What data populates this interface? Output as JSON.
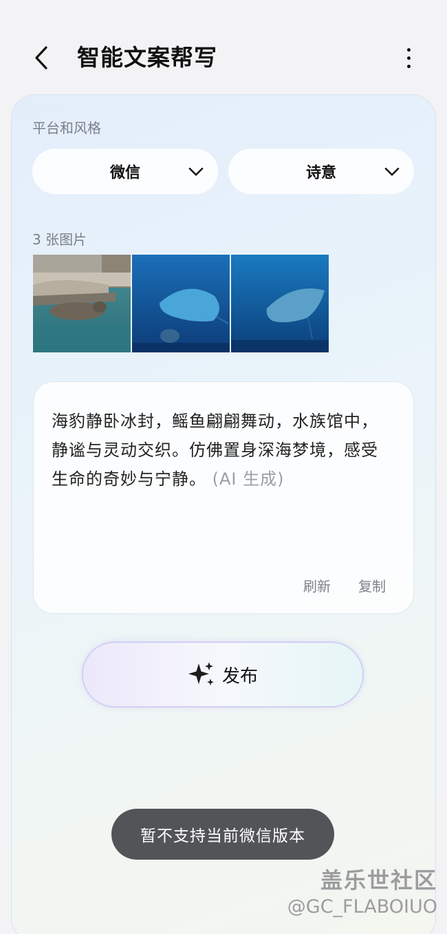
{
  "header": {
    "title": "智能文案帮写",
    "back_icon": "chevron-left-icon",
    "more_icon": "more-vertical-icon"
  },
  "platform_section": {
    "label": "平台和风格",
    "platform": {
      "value": "微信",
      "icon": "chevron-down-icon"
    },
    "style": {
      "value": "诗意",
      "icon": "chevron-down-icon"
    }
  },
  "images_section": {
    "label": "3 张图片",
    "images": [
      {
        "subject": "seal"
      },
      {
        "subject": "stingray"
      },
      {
        "subject": "stingray"
      }
    ]
  },
  "generated": {
    "text": "海豹静卧冰封，鳐鱼翩翩舞动，水族馆中，静谧与灵动交织。仿佛置身深海梦境，感受生命的奇妙与宁静。",
    "ai_tag": "(AI 生成)",
    "refresh_label": "刷新",
    "copy_label": "复制"
  },
  "publish": {
    "label": "发布",
    "icon": "sparkle-icon"
  },
  "toast": {
    "message": "暂不支持当前微信版本"
  },
  "watermark": {
    "line1": "盖乐世社区",
    "line2": "@GC_FLABOIUO"
  }
}
